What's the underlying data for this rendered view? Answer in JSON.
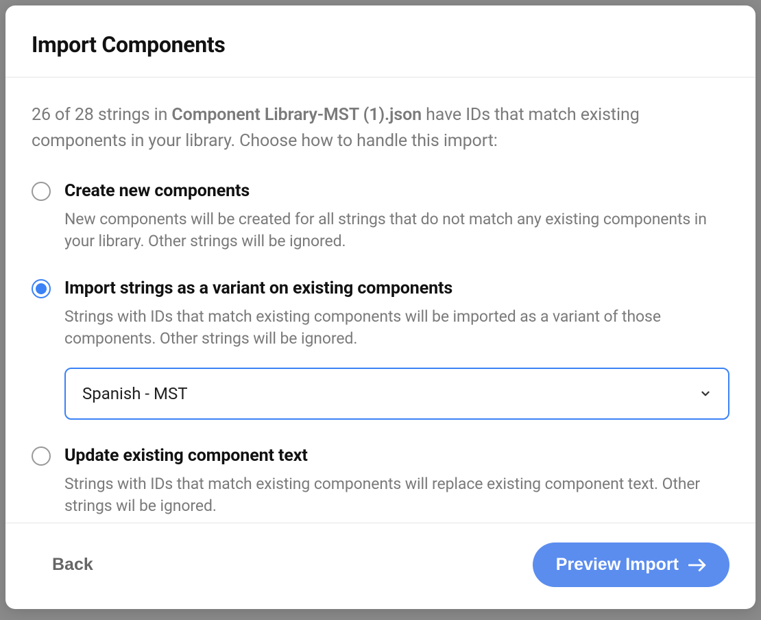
{
  "modal": {
    "title": "Import Components",
    "description": {
      "prefix": "26 of 28 strings in ",
      "filename": "Component Library-MST (1).json",
      "suffix": " have IDs that match existing components in your library. Choose how to handle this import:"
    },
    "options": [
      {
        "title": "Create new components",
        "desc": "New components will be created for all strings that do not match any existing components in your library. Other strings will be ignored."
      },
      {
        "title": "Import strings as a variant on existing components",
        "desc": "Strings with IDs that match existing components will be imported as a variant of those components. Other strings will be ignored.",
        "select_value": "Spanish - MST"
      },
      {
        "title": "Update existing component text",
        "desc": "Strings with IDs that match existing components will replace existing component text. Other strings wil be ignored."
      }
    ],
    "footer": {
      "back": "Back",
      "preview": "Preview Import"
    }
  }
}
